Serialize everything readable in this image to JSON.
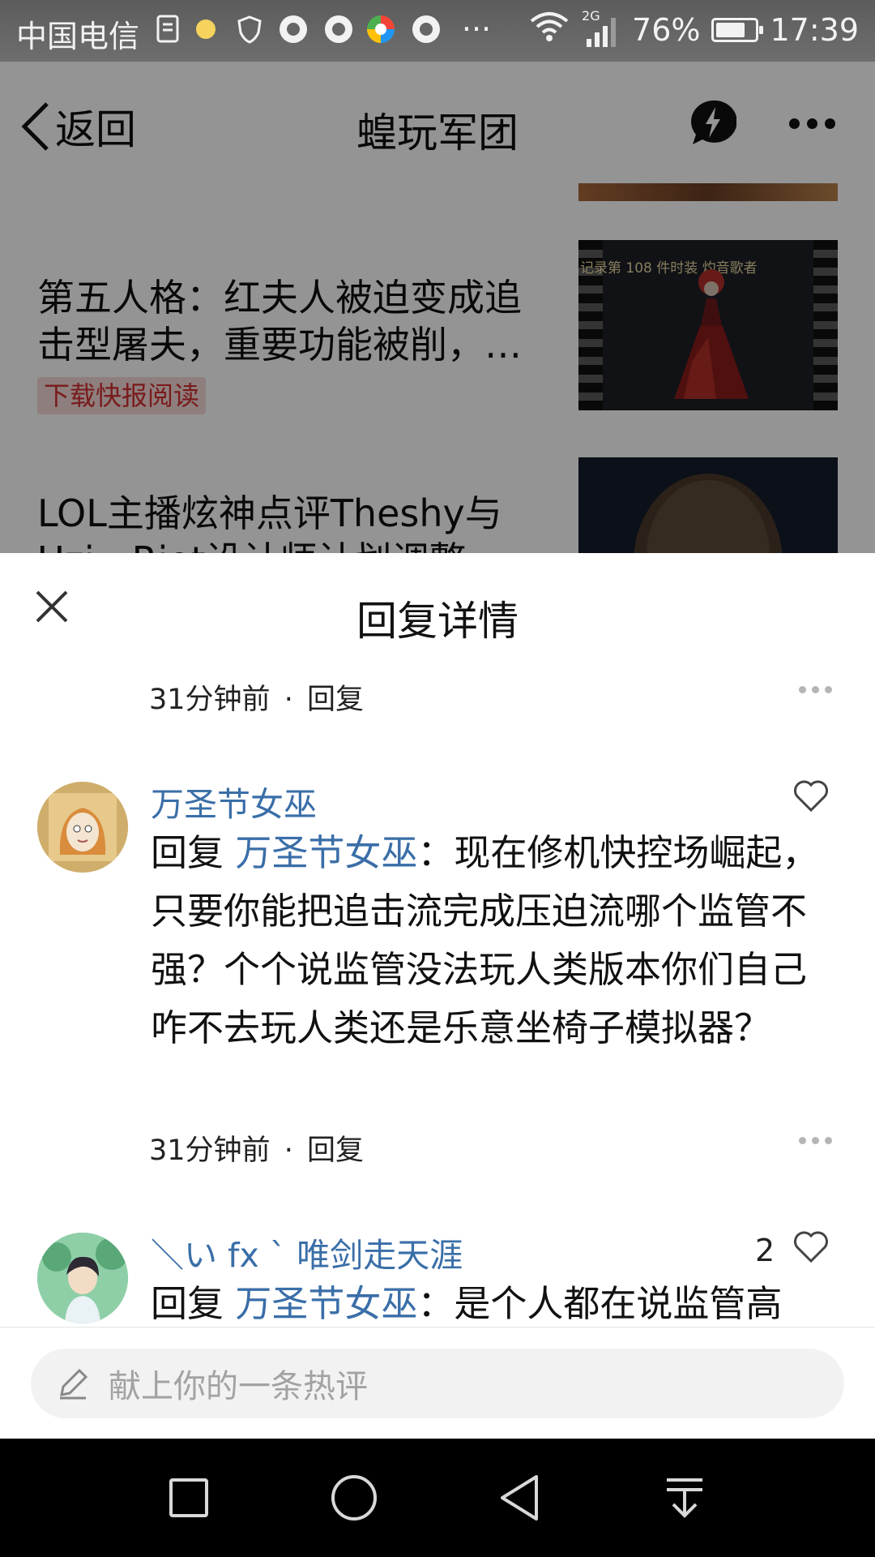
{
  "status_bar": {
    "carrier": "中国电信",
    "network": "2G",
    "battery": "76%",
    "battery_level": 0.76,
    "time": "17:39",
    "more": "···"
  },
  "background_page": {
    "back_label": "返回",
    "title": "蝗玩军团",
    "articles": [
      {
        "title_line1": "第五人格：红夫人被迫变成追",
        "title_line2": "击型屠夫，重要功能被削，…",
        "tag": "下载快报阅读",
        "thumb_caption": "记录第 108 件时装 灼音歌者"
      },
      {
        "title_line1": "LOL主播炫神点评Theshy与",
        "title_line2": "Uzi，Riot设计师计划调整"
      }
    ]
  },
  "sheet": {
    "title": "回复详情",
    "top_meta": {
      "time": "31分钟前",
      "separator": "·",
      "reply": "回复"
    },
    "comments": [
      {
        "username": "万圣节女巫",
        "prefix": "回复 ",
        "mention": "万圣节女巫",
        "colon": "：",
        "text": "现在修机快控场崛起，只要你能把追击流完成压迫流哪个监管不强？个个说监管没法玩人类版本你们自己咋不去玩人类还是乐意坐椅子模拟器？",
        "time": "31分钟前",
        "separator": "·",
        "reply": "回复",
        "likes": ""
      },
      {
        "username": "＼い fx ˋ 唯剑走天涯",
        "prefix": "回复 ",
        "mention": "万圣节女巫",
        "colon": "：",
        "text": "是个人都在说监管高",
        "likes": "2"
      }
    ]
  },
  "input": {
    "placeholder": "献上你的一条热评"
  },
  "icons": {
    "back": "chevron-left-icon",
    "flash": "lightning-chat-icon",
    "more": "more-dots-icon",
    "close": "close-icon",
    "like": "heart-icon",
    "edit": "pencil-icon",
    "nav": [
      "square-icon",
      "circle-icon",
      "triangle-back-icon",
      "download-arrow-icon"
    ]
  },
  "colors": {
    "link_blue": "#3a6ea8",
    "tag_red": "#d03030",
    "nav_bg": "#000000"
  }
}
